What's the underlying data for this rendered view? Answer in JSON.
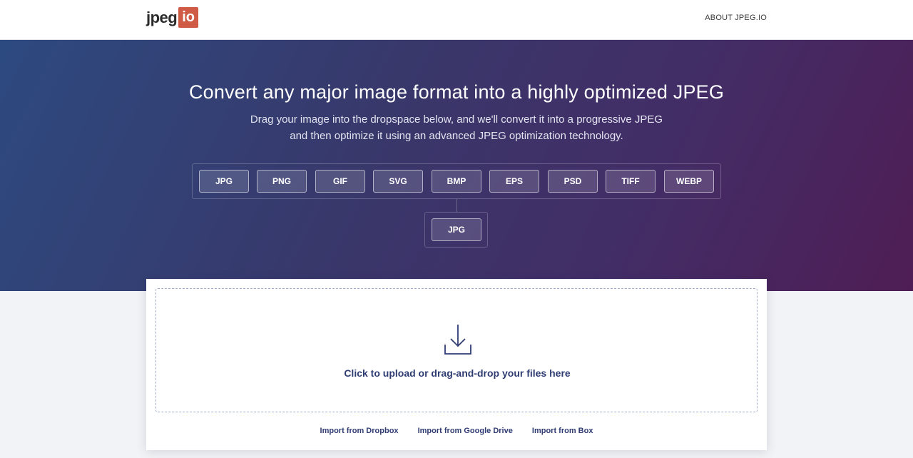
{
  "nav": {
    "logo_text": "jpeg",
    "logo_badge": "io",
    "about_link": "ABOUT JPEG.IO"
  },
  "hero": {
    "title": "Convert any major image format into a highly optimized JPEG",
    "subtitle_line1": "Drag your image into the dropspace below, and we'll convert it into a progressive JPEG",
    "subtitle_line2": "and then optimize it using an advanced JPEG optimization technology."
  },
  "input_formats": [
    "JPG",
    "PNG",
    "GIF",
    "SVG",
    "BMP",
    "EPS",
    "PSD",
    "TIFF",
    "WEBP"
  ],
  "output_format": "JPG",
  "upload": {
    "icon": "download-arrow-icon",
    "prompt": "Click to upload or drag-and-drop your files here"
  },
  "imports": {
    "dropbox": "Import from Dropbox",
    "google_drive": "Import from Google Drive",
    "box": "Import from Box"
  },
  "colors": {
    "logo_badge_bg": "#cf5a45",
    "accent_text": "#2f3c72",
    "hero_gradient_start": "#2d4a80",
    "hero_gradient_end": "#4f1d55"
  }
}
